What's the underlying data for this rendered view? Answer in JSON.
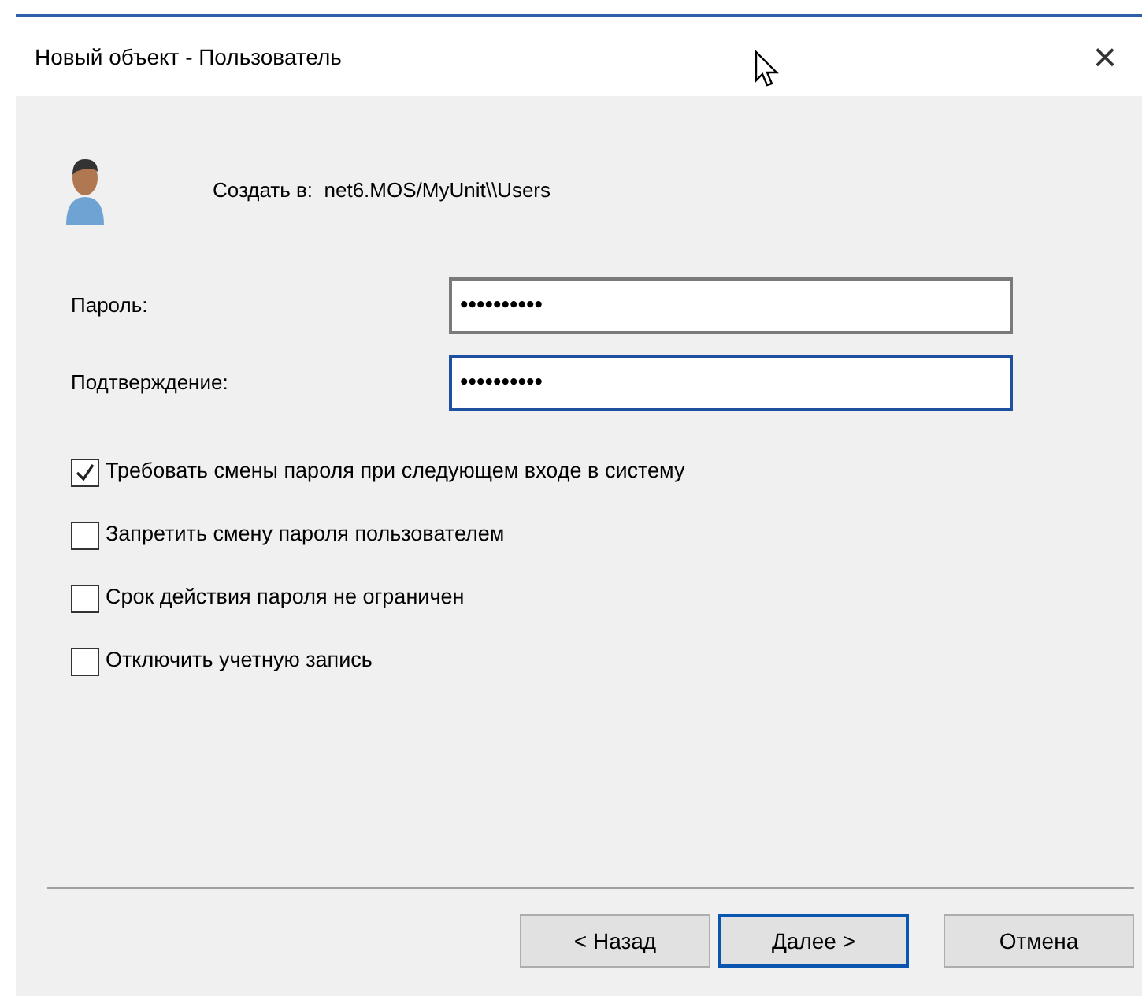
{
  "window": {
    "title": "Новый объект - Пользователь",
    "close": "×"
  },
  "header": {
    "text": "Создать в:  net6.MOS/MyUnit\\\\Users"
  },
  "fields": [
    {
      "label": "Пароль:",
      "value": "••••••••••",
      "focused": false
    },
    {
      "label": "Подтверждение:",
      "value": "••••••••••",
      "focused": true
    }
  ],
  "checkboxes": [
    {
      "label": "Требовать смены пароля при следующем входе в систему",
      "checked": true
    },
    {
      "label": "Запретить смену пароля пользователем",
      "checked": false
    },
    {
      "label": "Срок действия пароля не ограничен",
      "checked": false
    },
    {
      "label": "Отключить учетную запись",
      "checked": false
    }
  ],
  "buttons": [
    {
      "label": "< Назад",
      "default": false
    },
    {
      "label": "Далее >",
      "default": true
    },
    {
      "label": "Отмена",
      "default": false
    }
  ]
}
